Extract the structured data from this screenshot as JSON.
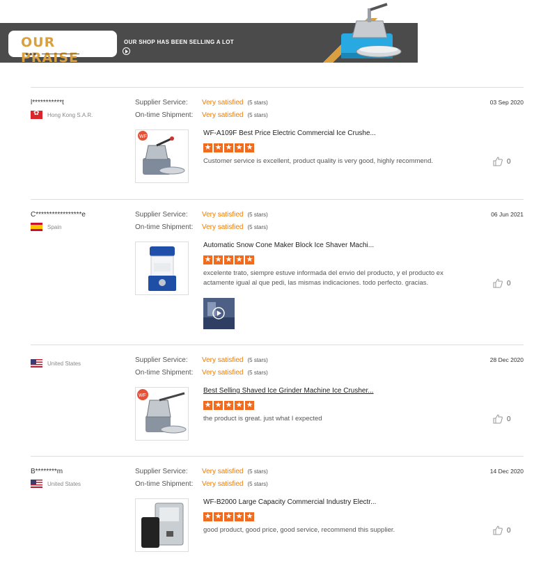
{
  "banner": {
    "title": "OUR PRAISE",
    "subtitle": "OUR SHOP HAS BEEN SELLING A LOT"
  },
  "colors": {
    "accent_gold": "#d9a042",
    "banner_dark": "#4b4b4b",
    "rating_orange": "#f07b00",
    "star_orange": "#f26b1d"
  },
  "reviews": [
    {
      "name": "l***********t",
      "country": "Hong Kong S.A.R.",
      "flag": "hk-flag",
      "supplier_label": "Supplier Service:",
      "supplier_value": "Very satisfied",
      "supplier_stars": "(5 stars)",
      "shipment_label": "On-time Shipment:",
      "shipment_value": "Very satisfied",
      "shipment_stars": "(5 stars)",
      "date": "03 Sep 2020",
      "product": "WF-A109F Best Price Electric Commercial Ice Crushe...",
      "rating": 5,
      "comment": "Customer service is excellent, product quality is very good, highly recommend.",
      "likes": "0"
    },
    {
      "name": "C*****************e",
      "country": "Spain",
      "flag": "es-flag",
      "supplier_label": "Supplier Service:",
      "supplier_value": "Very satisfied",
      "supplier_stars": "(5 stars)",
      "shipment_label": "On-time Shipment:",
      "shipment_value": "Very satisfied",
      "shipment_stars": "(5 stars)",
      "date": "06 Jun 2021",
      "product": "Automatic Snow Cone Maker Block Ice Shaver Machi...",
      "rating": 5,
      "comment": "excelente trato, siempre estuve informada del envio del producto, y el producto ex actamente igual al que pedi, las mismas indicaciones. todo perfecto. gracias.",
      "likes": "0"
    },
    {
      "name": "",
      "country": "United States",
      "flag": "us-flag",
      "supplier_label": "Supplier Service:",
      "supplier_value": "Very satisfied",
      "supplier_stars": "(5 stars)",
      "shipment_label": "On-time Shipment:",
      "shipment_value": "Very satisfied",
      "shipment_stars": "(5 stars)",
      "date": "28 Dec 2020",
      "product": "Best Selling Shaved Ice Grinder Machine Ice Crusher...",
      "rating": 5,
      "comment": "the product is great. just what I expected",
      "likes": "0"
    },
    {
      "name": "B********m",
      "country": "United States",
      "flag": "us-flag",
      "supplier_label": "Supplier Service:",
      "supplier_value": "Very satisfied",
      "supplier_stars": "(5 stars)",
      "shipment_label": "On-time Shipment:",
      "shipment_value": "Very satisfied",
      "shipment_stars": "(5 stars)",
      "date": "14 Dec 2020",
      "product": "WF-B2000 Large Capacity Commercial Industry Electr...",
      "rating": 5,
      "comment": "good product, good price, good service, recommend this supplier.",
      "likes": "0"
    }
  ]
}
